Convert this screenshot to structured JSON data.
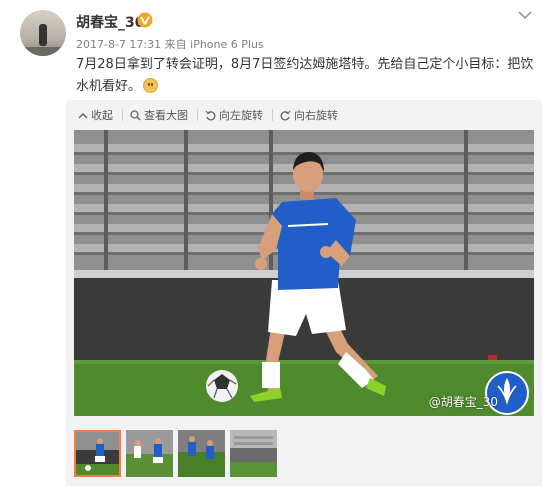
{
  "post": {
    "username": "胡春宝_30",
    "time": "2017-8-7 17:31",
    "source_prefix": "来自",
    "source": "iPhone 6 Plus",
    "text_line1": "7月28日拿到了转会证明，8月7日签约达姆施塔特。先给自己定个小目标：把饮",
    "text_line2": "水机看好。",
    "emoji": "smile-emoji"
  },
  "toolbar": {
    "collapse": "收起",
    "view_large": "查看大图",
    "rotate_left": "向左旋转",
    "rotate_right": "向右旋转"
  },
  "photo": {
    "watermark": "@胡春宝_30",
    "jersey_color": "#1f5fc7",
    "pitch_color": "#4f8a2e"
  },
  "thumbnails": {
    "count": 4,
    "selected": 1
  },
  "colors": {
    "accent": "#fa7d3c",
    "vip_badge": "#f5a623",
    "text_gray": "#808080"
  }
}
